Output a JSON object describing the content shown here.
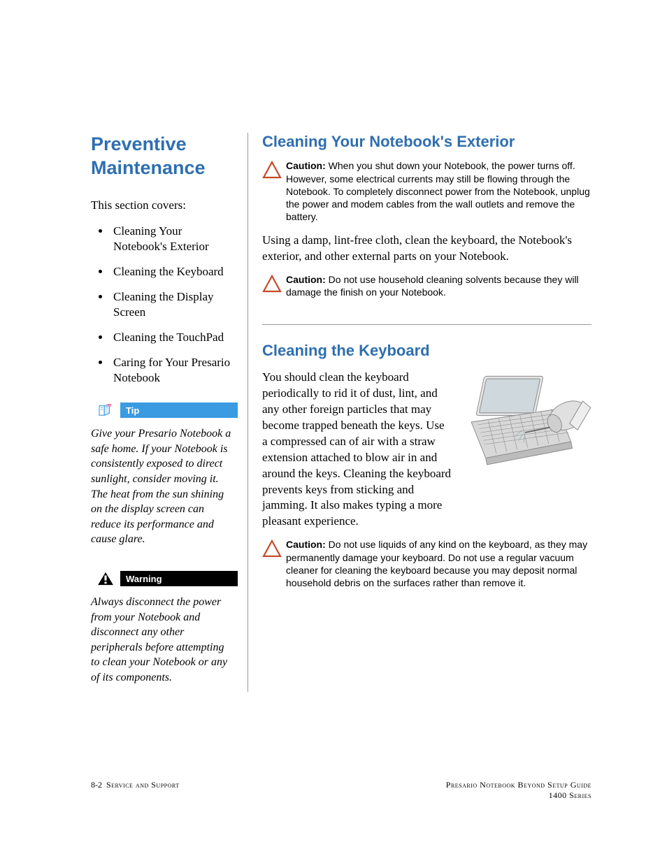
{
  "left": {
    "h1": "Preventive Maintenance",
    "intro": "This section covers:",
    "items": [
      "Cleaning Your Notebook's Exterior",
      "Cleaning the Keyboard",
      "Cleaning the Display Screen",
      "Cleaning the TouchPad",
      "Caring for Your Presario Notebook"
    ],
    "tip_label": "Tip",
    "tip_text": "Give your Presario Notebook a safe home. If your Notebook is consistently exposed to direct sunlight, consider moving it. The heat from the sun shining on the display screen can reduce its performance and cause glare.",
    "warn_label": "Warning",
    "warn_text": "Always disconnect the power from your Notebook and disconnect any other peripherals before attempting to clean your Notebook or any of its components."
  },
  "right": {
    "h2a": "Cleaning Your Notebook's Exterior",
    "caution_a_label": "Caution:",
    "caution_a_text": " When you shut down your Notebook, the power turns off. However, some electrical currents may still be flowing through the Notebook. To completely disconnect power from the Notebook, unplug the power and modem cables from the wall outlets and remove the battery.",
    "para_a": "Using a damp, lint-free cloth, clean the keyboard, the Notebook's exterior, and other external parts on your Notebook.",
    "caution_b_label": "Caution:",
    "caution_b_text": " Do not use household cleaning solvents because they will damage the finish on your Notebook.",
    "h2b": "Cleaning the Keyboard",
    "para_b": "You should clean the keyboard periodically to rid it of dust, lint, and any other foreign particles that may become trapped beneath the keys. Use a compressed can of air with a straw extension attached to blow air in and around the keys. Cleaning the keyboard prevents keys from sticking and jamming. It also makes typing a more pleasant experience.",
    "caution_c_label": "Caution:",
    "caution_c_text": " Do not use liquids of any kind on the keyboard, as they may permanently damage your keyboard. Do not use a regular vacuum cleaner for cleaning the keyboard because you may deposit normal household debris on the surfaces rather than remove it."
  },
  "footer": {
    "page_num": "8-2",
    "left_label": "Service and Support",
    "right_line1": "Presario Notebook Beyond Setup Guide",
    "right_line2": "1400 Series"
  }
}
